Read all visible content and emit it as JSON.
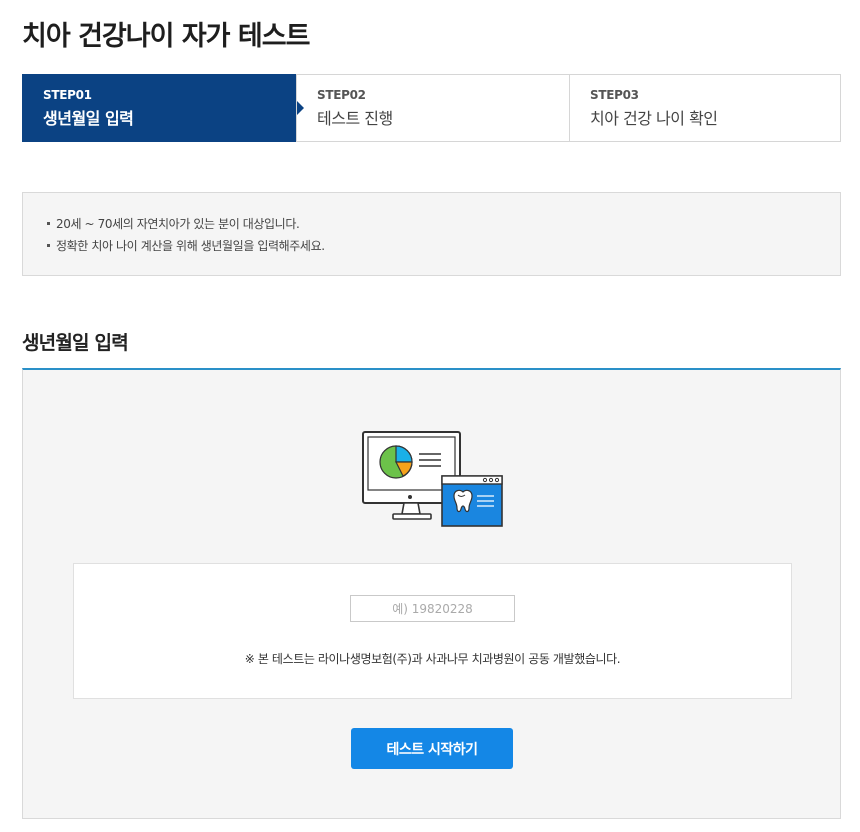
{
  "page": {
    "title": "치아 건강나이 자가 테스트"
  },
  "steps": [
    {
      "no": "STEP01",
      "label": "생년월일 입력",
      "active": true
    },
    {
      "no": "STEP02",
      "label": "테스트 진행",
      "active": false
    },
    {
      "no": "STEP03",
      "label": "치아 건강 나이 확인",
      "active": false
    }
  ],
  "notice": {
    "items": [
      "20세 ~ 70세의 자연치아가 있는 분이 대상입니다.",
      "정확한 치아 나이 계산을 위해 생년월일을 입력해주세요."
    ]
  },
  "section": {
    "title": "생년월일 입력"
  },
  "form": {
    "birth_value": "",
    "birth_placeholder": "예) 19820228",
    "disclaimer": "※ 본 테스트는 라이나생명보험(주)과 사과나무 치과병원이 공동 개발했습니다.",
    "start_label": "테스트 시작하기"
  },
  "illustration": {
    "icon": "monitor-tooth-chart-icon"
  },
  "colors": {
    "step_active": "#0b4283",
    "accent_line": "#2a90c8",
    "button": "#1487e6",
    "pie_green": "#6cc24a",
    "pie_blue": "#1ab0e8",
    "pie_orange": "#f5a21b"
  }
}
